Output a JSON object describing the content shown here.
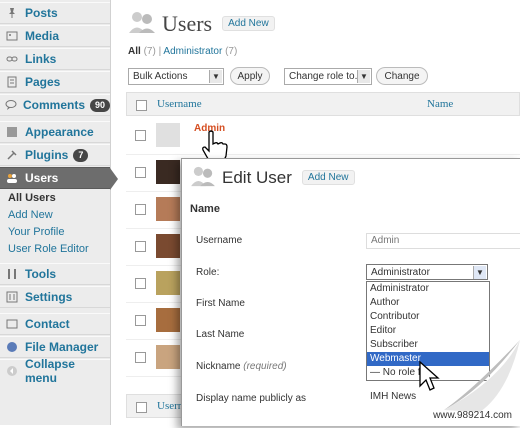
{
  "sidebar": {
    "items": [
      {
        "label": "Posts",
        "icon": "pushpin-icon"
      },
      {
        "label": "Media",
        "icon": "media-icon"
      },
      {
        "label": "Links",
        "icon": "links-icon"
      },
      {
        "label": "Pages",
        "icon": "pages-icon"
      },
      {
        "label": "Comments",
        "icon": "comments-icon",
        "badge": "90"
      },
      {
        "label": "Appearance",
        "icon": "appearance-icon"
      },
      {
        "label": "Plugins",
        "icon": "plugins-icon",
        "badge": "7"
      },
      {
        "label": "Users",
        "icon": "users-icon",
        "active": true
      },
      {
        "label": "Tools",
        "icon": "tools-icon"
      },
      {
        "label": "Settings",
        "icon": "settings-icon"
      },
      {
        "label": "Contact",
        "icon": "contact-icon"
      },
      {
        "label": "File Manager",
        "icon": "file-manager-icon"
      },
      {
        "label": "Collapse menu",
        "icon": "collapse-icon"
      }
    ],
    "users_submenu": [
      "All Users",
      "Add New",
      "Your Profile",
      "User Role Editor"
    ]
  },
  "header": {
    "title": "Users",
    "add_new": "Add New"
  },
  "views": {
    "all": "All",
    "all_count": "(7)",
    "admin": "Administrator",
    "admin_count": "(7)"
  },
  "toolbar": {
    "bulk_actions": "Bulk Actions",
    "apply": "Apply",
    "change_role": "Change role to...",
    "change": "Change"
  },
  "table": {
    "columns": [
      "Username",
      "Name"
    ],
    "first_row_username": "Admin"
  },
  "edit_user": {
    "title": "Edit User",
    "add_new": "Add New",
    "section": "Name",
    "fields": {
      "username_label": "Username",
      "username_value": "Admin",
      "role_label": "Role:",
      "role_value": "Administrator",
      "first_name_label": "First Name",
      "last_name_label": "Last Name",
      "nickname_label": "Nickname",
      "nickname_required": "(required)",
      "display_label": "Display name publicly as",
      "display_value": "IMH News"
    },
    "role_options": [
      "Administrator",
      "Author",
      "Contributor",
      "Editor",
      "Subscriber",
      "Webmaster",
      "— No role for"
    ],
    "selected_role": "Webmaster"
  },
  "watermark": "www.989214.com",
  "colors": {
    "link": "#21759b",
    "active_menu": "#6d6d6d",
    "selected_option": "#3169c6"
  }
}
